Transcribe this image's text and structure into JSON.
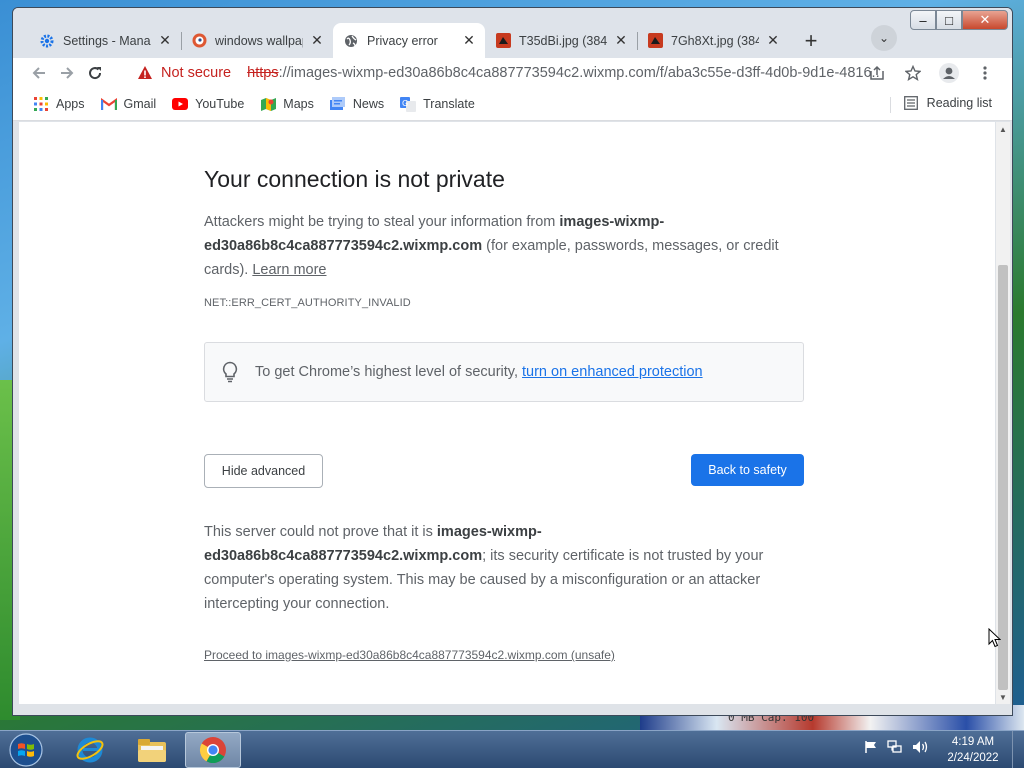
{
  "window_controls": {
    "minimize": "‒",
    "maximize": "□",
    "close": "✕"
  },
  "tabs": [
    {
      "label": "Settings - Manag",
      "icon": "gear-icon",
      "active": false
    },
    {
      "label": "windows wallpap",
      "icon": "duckduckgo-icon",
      "active": false
    },
    {
      "label": "Privacy error",
      "icon": "globe-icon",
      "active": true
    },
    {
      "label": "T35dBi.jpg (384",
      "icon": "deviantart-icon",
      "active": false
    },
    {
      "label": "7Gh8Xt.jpg (384",
      "icon": "deviantart-icon",
      "active": false
    }
  ],
  "toolbar": {
    "security_label": "Not secure",
    "url_scheme": "https",
    "url_rest": "://images-wixmp-ed30a86b8c4ca887773594c2.wixmp.com/f/aba3c55e-d3ff-4d0b-9d1e-4816..."
  },
  "bookmarks": [
    {
      "label": "Apps",
      "icon": "apps-grid-icon"
    },
    {
      "label": "Gmail",
      "icon": "gmail-icon"
    },
    {
      "label": "YouTube",
      "icon": "youtube-icon"
    },
    {
      "label": "Maps",
      "icon": "maps-icon"
    },
    {
      "label": "News",
      "icon": "news-icon"
    },
    {
      "label": "Translate",
      "icon": "translate-icon"
    }
  ],
  "reading_list": "Reading list",
  "page": {
    "title": "Your connection is not private",
    "p1_before": "Attackers might be trying to steal your information from ",
    "p1_domain": "images-wixmp-ed30a86b8c4ca887773594c2.wixmp.com",
    "p1_after": " (for example, passwords, messages, or credit cards). ",
    "learn_more": "Learn more",
    "error_code": "NET::ERR_CERT_AUTHORITY_INVALID",
    "enhanced_text": "To get Chrome’s highest level of security,",
    "enhanced_link": "turn on enhanced protection",
    "hide_advanced": "Hide advanced",
    "back_to_safety": "Back to safety",
    "p2_before": "This server could not prove that it is ",
    "p2_domain": "images-wixmp-ed30a86b8c4ca887773594c2.wixmp.com",
    "p2_after": "; its security certificate is not trusted by your computer's operating system. This may be caused by a misconfiguration or an attacker intercepting your connection.",
    "proceed": "Proceed to images-wixmp-ed30a86b8c4ca887773594c2.wixmp.com (unsafe)"
  },
  "taskbar": {
    "apps": [
      "internet-explorer-icon",
      "file-explorer-icon",
      "chrome-icon"
    ],
    "time": "4:19 AM",
    "date": "2/24/2022"
  },
  "colors": {
    "accent": "#1a73e8",
    "warning": "#c5221f"
  }
}
